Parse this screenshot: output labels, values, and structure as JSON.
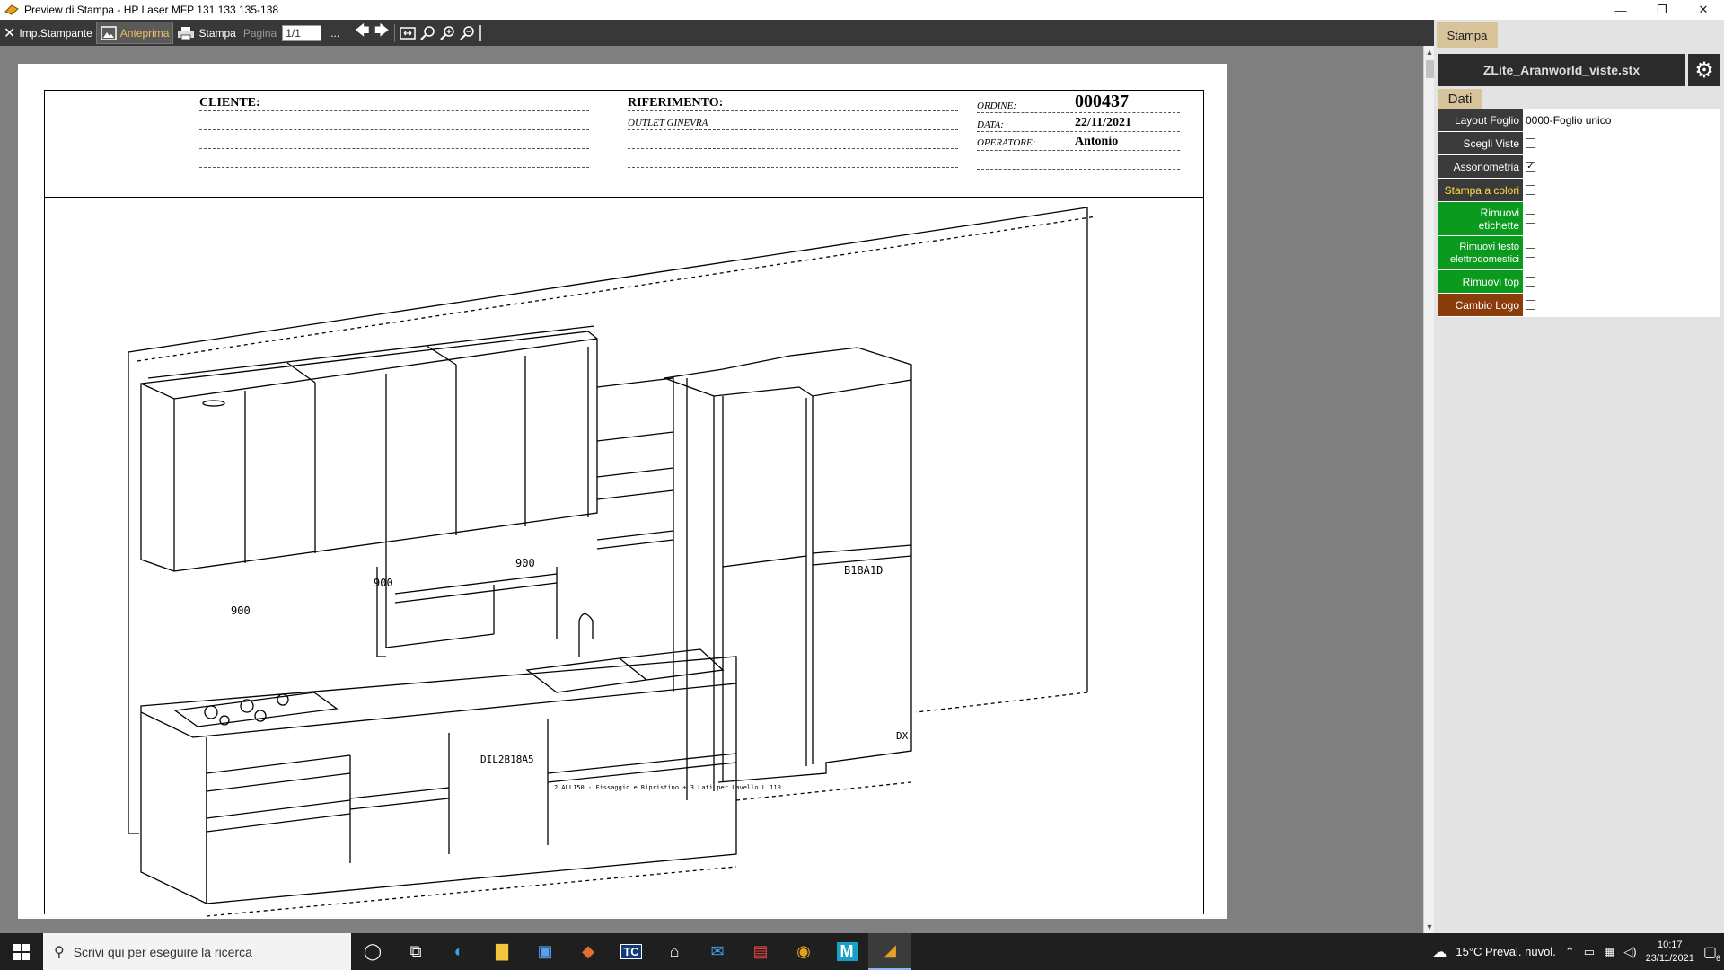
{
  "window": {
    "title": "Preview di Stampa - HP Laser MFP 131 133 135-138",
    "minimize": "—",
    "restore": "❐",
    "close": "✕"
  },
  "toolbar": {
    "imp_stampante": "Imp.Stampante",
    "anteprima": "Anteprima",
    "stampa": "Stampa",
    "pagina": "Pagina",
    "page_value": "1/1",
    "more": "..."
  },
  "sheet": {
    "cliente_label": "CLIENTE:",
    "riferimento_label": "RIFERIMENTO:",
    "riferimento_value": "OUTLET GINEVRA",
    "ordine_label": "ORDINE:",
    "ordine_value": "000437",
    "data_label": "DATA:",
    "data_value": "22/11/2021",
    "operatore_label": "OPERATORE:",
    "operatore_value": "Antonio"
  },
  "drawing_labels": {
    "w1": "900",
    "w2": "900",
    "w3": "900",
    "tall": "B18A1D",
    "base": "DIL2B18A5",
    "dx": "DX",
    "note": "2 ALL150 - Fissaggio e Ripristino + 3 Lati per Lavello L 110"
  },
  "panel": {
    "tab_stampa": "Stampa",
    "file_name": "ZLite_Aranworld_viste.stx",
    "tab_dati": "Dati",
    "rows": [
      {
        "label": "Layout Foglio",
        "value": "0000-Foglio unico",
        "type": "text",
        "style": "dark"
      },
      {
        "label": "Scegli Viste",
        "checked": false,
        "type": "check",
        "style": "dark"
      },
      {
        "label": "Assonometria",
        "checked": true,
        "type": "check",
        "style": "dark"
      },
      {
        "label": "Stampa a colori",
        "checked": false,
        "type": "check",
        "style": "yellow"
      },
      {
        "label": "Rimuovi etichette",
        "checked": false,
        "type": "check",
        "style": "green"
      },
      {
        "label": "Rimuovi testo elettrodomestici",
        "checked": false,
        "type": "check",
        "style": "green"
      },
      {
        "label": "Rimuovi top",
        "checked": false,
        "type": "check",
        "style": "green"
      },
      {
        "label": "Cambio Logo",
        "checked": false,
        "type": "check",
        "style": "brown"
      }
    ]
  },
  "taskbar": {
    "search_placeholder": "Scrivi qui per eseguire la ricerca",
    "weather": "15°C  Preval. nuvol.",
    "time": "10:17",
    "date": "23/11/2021",
    "notif_count": "6"
  }
}
